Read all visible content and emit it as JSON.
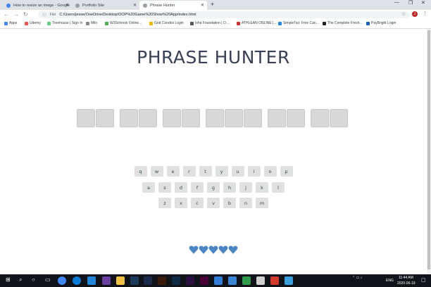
{
  "browser": {
    "tabs": [
      {
        "label": "How to resize an image - Google",
        "color": "#4285f4"
      },
      {
        "label": "Portfolio Site",
        "color": "#5f6368"
      },
      {
        "label": "Phrase Hunter",
        "color": "#5f6368"
      }
    ],
    "url_label": "File",
    "url": "C:/Users/jesse/OneDrive/Desktop/OOP%20Game%20Show%20App/index.html",
    "avatar": "J",
    "bookmarks": [
      {
        "label": "Apps",
        "color": "#4285f4"
      },
      {
        "label": "Udemy",
        "color": "#ec5252"
      },
      {
        "label": "Treehouse | Sign In",
        "color": "#5fcf80"
      },
      {
        "label": "Milo",
        "color": "#888888"
      },
      {
        "label": "W3Schools Online...",
        "color": "#4caf50"
      },
      {
        "label": "Grid Condos Login",
        "color": "#f4b400"
      },
      {
        "label": "Isha Foundation | O...",
        "color": "#555555"
      },
      {
        "label": "ATHLEAN ONLINE |...",
        "color": "#d32f2f"
      },
      {
        "label": "SimpleTax: Free Can...",
        "color": "#1e88e5"
      },
      {
        "label": "The Complete Fresh...",
        "color": "#222222"
      },
      {
        "label": "PayBright Login",
        "color": "#1565c0"
      }
    ]
  },
  "game": {
    "title": "PHRASE HUNTER",
    "phrase_word_lengths": [
      2,
      2,
      2,
      3,
      2,
      2
    ],
    "keyboard": [
      [
        "q",
        "w",
        "e",
        "r",
        "t",
        "y",
        "u",
        "i",
        "o",
        "p"
      ],
      [
        "a",
        "s",
        "d",
        "f",
        "g",
        "h",
        "j",
        "k",
        "l"
      ],
      [
        "z",
        "x",
        "c",
        "v",
        "b",
        "n",
        "m"
      ]
    ],
    "lives": 5,
    "heart_color": "#4a86c5"
  },
  "taskbar": {
    "lang": "ENG",
    "time": "11:44 AM",
    "date": "2020-06-19"
  }
}
